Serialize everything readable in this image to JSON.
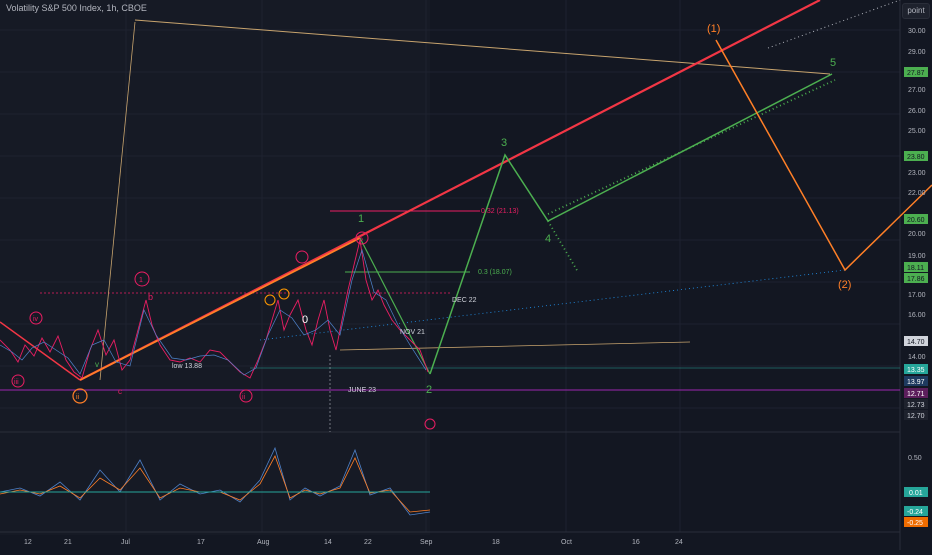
{
  "header": {
    "title": "Volatility S&P 500 Index, 1h, CBOE",
    "scale_toggle": "point"
  },
  "price_axis": {
    "ticks": [
      "30.00",
      "29.00",
      "28.00",
      "27.00",
      "26.00",
      "25.00",
      "24.00",
      "23.00",
      "22.00",
      "21.00",
      "20.00",
      "19.00",
      "18.00",
      "17.00",
      "16.00",
      "15.00",
      "14.00",
      "13.00",
      "12.00"
    ],
    "badges": [
      {
        "label": "27.87",
        "color": "#4caf50"
      },
      {
        "label": "23.80",
        "color": "#4caf50"
      },
      {
        "label": "20.60",
        "color": "#4caf50"
      },
      {
        "label": "18.11",
        "color": "#4caf50"
      },
      {
        "label": "17.86",
        "color": "#4caf50"
      },
      {
        "label": "14.70",
        "color": "#d1d4dc"
      },
      {
        "label": "13.35",
        "color": "#26a69a"
      },
      {
        "label": "13.97",
        "color": "#1e3a5f"
      },
      {
        "label": "12.71",
        "color": "#5c1e5c"
      },
      {
        "label": "12.73",
        "color": "#1e222d"
      },
      {
        "label": "12.70",
        "color": "#1e222d"
      }
    ]
  },
  "indicator_axis": {
    "ticks": [
      "0.50",
      "-0.50"
    ],
    "badges": [
      {
        "label": "0.01",
        "color": "#26a69a"
      },
      {
        "label": "-0.24",
        "color": "#26a69a"
      },
      {
        "label": "-0.25",
        "color": "#ef6c00"
      }
    ]
  },
  "time_axis": [
    "12",
    "21",
    "Jul",
    "17",
    "Aug",
    "14",
    "22",
    "Sep",
    "18",
    "Oct",
    "16",
    "24"
  ],
  "annotations": {
    "fib_1": "0.32 (21.13)",
    "fib_2": "0.3 (18.07)",
    "dec22": "DEC 22",
    "nov21": "NOV 21",
    "june23": "JUNE 23",
    "low": "low 13.88",
    "wave_1": "1",
    "wave_2": "2",
    "wave_3": "3",
    "wave_4": "4",
    "wave_5": "5",
    "big_1": "(1)",
    "big_2": "(2)",
    "circle_1": "1",
    "circle_ii": "ii",
    "circle_iv": "iv",
    "circle_iii": "iii",
    "circle_5": "5",
    "b": "b",
    "c": "c",
    "zero": "0",
    "v": "v"
  },
  "colors": {
    "background": "#131722",
    "grid": "#1e2230",
    "red_line": "#f23645",
    "orange_line": "#ff7f27",
    "green_line": "#4caf50",
    "tan_line": "#c8a46e",
    "magenta": "#e91e63",
    "teal": "#26a69a"
  }
}
